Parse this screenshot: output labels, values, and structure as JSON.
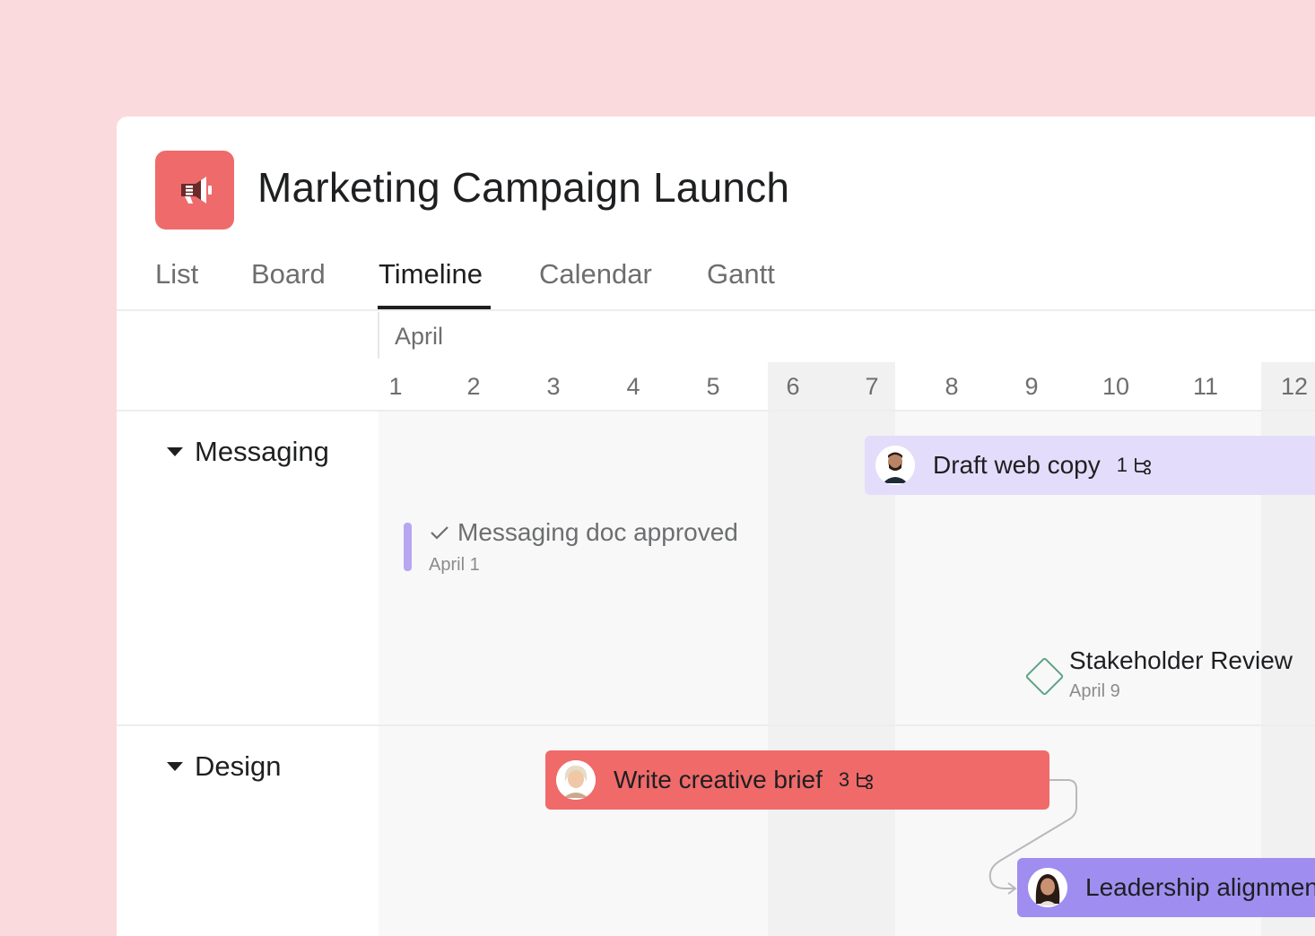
{
  "project": {
    "title": "Marketing Campaign Launch",
    "icon": "megaphone-icon",
    "icon_color": "#ef6b6b"
  },
  "tabs": [
    {
      "label": "List",
      "active": false
    },
    {
      "label": "Board",
      "active": false
    },
    {
      "label": "Timeline",
      "active": true
    },
    {
      "label": "Calendar",
      "active": false
    },
    {
      "label": "Gantt",
      "active": false
    }
  ],
  "timeline": {
    "month": "April",
    "days": [
      "1",
      "2",
      "3",
      "4",
      "5",
      "6",
      "7",
      "8",
      "9",
      "10",
      "11",
      "12"
    ],
    "weekend_days": [
      "6",
      "7",
      "12"
    ]
  },
  "groups": [
    {
      "label": "Messaging"
    },
    {
      "label": "Design"
    }
  ],
  "tasks": {
    "draft_web_copy": {
      "title": "Draft web copy",
      "subtasks": "1",
      "color": "#e3dcfa"
    },
    "write_creative_brief": {
      "title": "Write creative brief",
      "subtasks": "3",
      "color": "#f06a6a"
    },
    "leadership_alignment": {
      "title": "Leadership alignment",
      "color": "#9f8ef0"
    }
  },
  "milestones": {
    "messaging_doc": {
      "title": "Messaging doc approved",
      "date": "April 1",
      "status": "completed"
    },
    "stakeholder_review": {
      "title": "Stakeholder Review",
      "date": "April 9"
    }
  }
}
